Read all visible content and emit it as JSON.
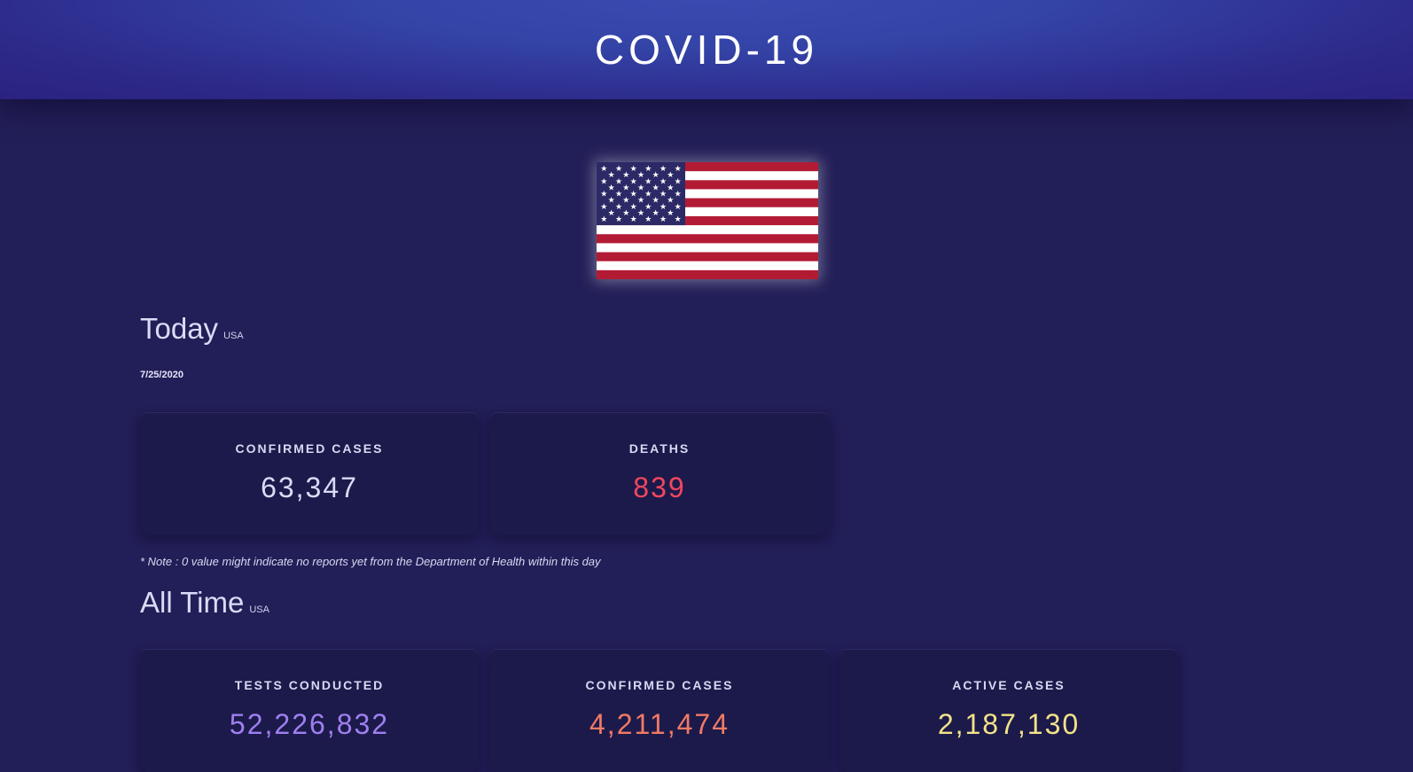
{
  "header": {
    "title": "COVID-19"
  },
  "flag": {
    "country": "USA"
  },
  "today": {
    "title": "Today",
    "region": "USA",
    "date": "7/25/2020",
    "cards": [
      {
        "label": "CONFIRMED CASES",
        "value": "63,347",
        "color": "#d8dbf6"
      },
      {
        "label": "DEATHS",
        "value": "839",
        "color": "#f0465f"
      }
    ],
    "note": "* Note : 0 value might indicate no reports yet from the Department of Health within this day"
  },
  "all_time": {
    "title": "All Time",
    "region": "USA",
    "cards": [
      {
        "label": "TESTS CONDUCTED",
        "value": "52,226,832",
        "color": "#9f7ff0"
      },
      {
        "label": "CONFIRMED CASES",
        "value": "4,211,474",
        "color": "#f07a66"
      },
      {
        "label": "ACTIVE CASES",
        "value": "2,187,130",
        "color": "#f2e28a"
      }
    ]
  }
}
